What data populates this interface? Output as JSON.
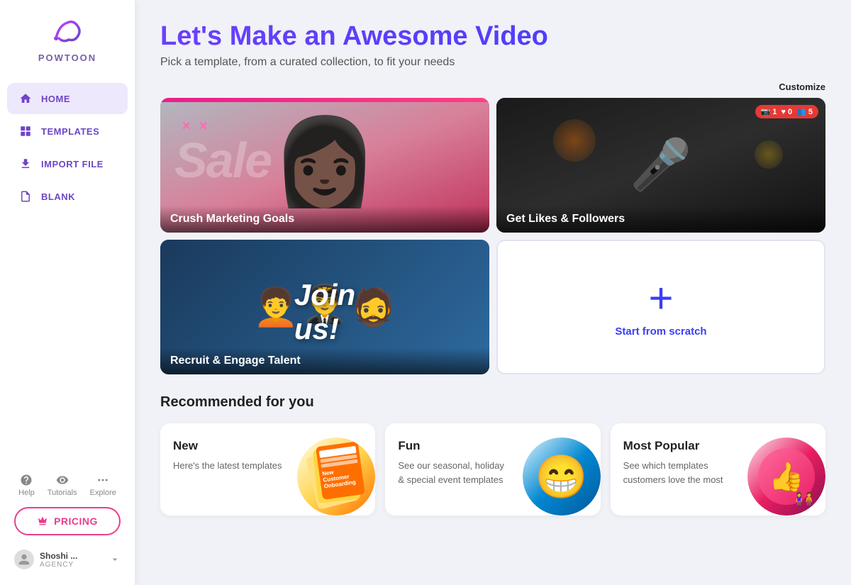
{
  "app": {
    "name": "POWTOON"
  },
  "sidebar": {
    "nav_items": [
      {
        "id": "home",
        "label": "HOME",
        "active": true,
        "icon": "home-icon"
      },
      {
        "id": "templates",
        "label": "TEMPLATES",
        "active": false,
        "icon": "templates-icon"
      },
      {
        "id": "import",
        "label": "IMPORT FILE",
        "active": false,
        "icon": "import-icon"
      },
      {
        "id": "blank",
        "label": "BLANK",
        "active": false,
        "icon": "blank-icon"
      }
    ],
    "bottom": {
      "help": "Help",
      "tutorials": "Tutorials",
      "explore": "Explore",
      "pricing_button": "PRICING",
      "user_name": "Shoshi ...",
      "user_role": "AGENCY"
    }
  },
  "main": {
    "title": "Let's Make an Awesome Video",
    "subtitle": "Pick a template, from a curated collection, to fit your needs",
    "customize_link": "Customize",
    "templates": [
      {
        "id": "crush",
        "label": "Crush Marketing Goals",
        "type": "image"
      },
      {
        "id": "followers",
        "label": "Get Likes & Followers",
        "type": "image",
        "badge": "1  ♥ 0  👥 5"
      },
      {
        "id": "recruit",
        "label": "Recruit & Engage Talent",
        "type": "image"
      },
      {
        "id": "scratch",
        "label": "Start from scratch",
        "type": "action",
        "plus_icon": "+"
      }
    ],
    "recommended": {
      "title": "Recommended for you",
      "cards": [
        {
          "id": "new",
          "title": "New",
          "description": "Here's the latest templates"
        },
        {
          "id": "fun",
          "title": "Fun",
          "description": "See our seasonal, holiday & special event templates"
        },
        {
          "id": "popular",
          "title": "Most Popular",
          "description": "See which templates customers love the most"
        }
      ]
    }
  }
}
